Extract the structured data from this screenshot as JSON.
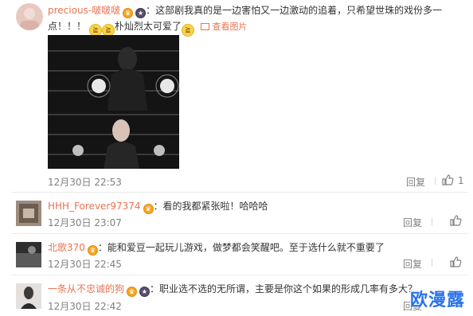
{
  "colors": {
    "username": "#eb7350",
    "meta": "#808080",
    "watermark": "#2a73e8"
  },
  "comments": [
    {
      "username": "precious-啵啵啵",
      "text_line1": "：这部剧我真的是一边害怕又一边激动的追着，只希望世珠的戏份多一",
      "text_line2": "点！！！",
      "text_line2b": "朴灿烈太可爱了",
      "pic_link": "查看图片",
      "time": "12月30日 22:53",
      "reply": "回复",
      "likes": "1"
    },
    {
      "username": "HHH_Forever97374",
      "text": "：看的我都紧张啦！哈哈哈",
      "time": "12月30日 23:07",
      "reply": "回复",
      "likes": ""
    },
    {
      "username": "北歌370",
      "text": "：能和爱豆一起玩儿游戏，做梦都会笑醒吧。至于选什么就不重要了",
      "time": "12月30日 22:45",
      "reply": "回复",
      "likes": ""
    },
    {
      "username": "一条从不忠诚的狗",
      "text": "：职业选不选的无所谓，主要是你这个如果的形成几率有多大？",
      "time": "12月30日 22:42",
      "reply": "回复",
      "likes": ""
    }
  ],
  "icons": {
    "vip": "crown-badge-icon",
    "member": "member-badge-icon",
    "emoji": "laughing-emoji-icon",
    "like": "thumbs-up-icon",
    "picture": "picture-icon"
  },
  "watermark": "欧漫露"
}
